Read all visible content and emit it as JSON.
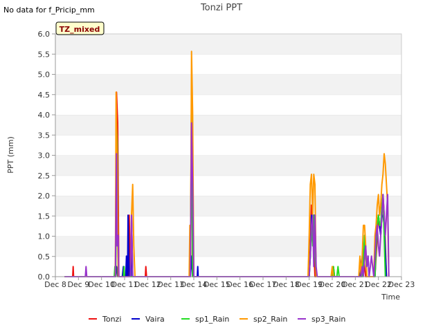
{
  "no_data_note": "No data for f_Pricip_mm",
  "tz_badge": "TZ_mixed",
  "chart_data": {
    "type": "line",
    "title": "Tonzi PPT",
    "xlabel": "Time",
    "ylabel": "PPT (mm)",
    "xlim": [
      8,
      23
    ],
    "ylim": [
      0,
      6
    ],
    "x_ticks": [
      8,
      9,
      10,
      11,
      12,
      13,
      14,
      15,
      16,
      17,
      18,
      19,
      20,
      21,
      22,
      23
    ],
    "x_tick_labels": [
      "Dec 8",
      "Dec 9",
      "Dec 10",
      "Dec 11",
      "Dec 12",
      "Dec 13",
      "Dec 14",
      "Dec 15",
      "Dec 16",
      "Dec 17",
      "Dec 18",
      "Dec 19",
      "Dec 20",
      "Dec 21",
      "Dec 22",
      "Dec 23"
    ],
    "y_ticks": [
      0,
      0.5,
      1,
      1.5,
      2,
      2.5,
      3,
      3.5,
      4,
      4.5,
      5,
      5.5,
      6
    ],
    "y_tick_labels": [
      "0.0",
      "0.5",
      "1.0",
      "1.5",
      "2.0",
      "2.5",
      "3.0",
      "3.5",
      "4.0",
      "4.5",
      "5.0",
      "5.5",
      "6.0"
    ],
    "grid": "horizontal bands",
    "legend_position": "bottom",
    "series": [
      {
        "name": "Tonzi",
        "color": "#ee1111",
        "points": [
          [
            8.4,
            0
          ],
          [
            8.75,
            0
          ],
          [
            8.77,
            0.25
          ],
          [
            8.79,
            0
          ],
          [
            10.6,
            0
          ],
          [
            10.65,
            4.56
          ],
          [
            10.7,
            3.8
          ],
          [
            10.75,
            0
          ],
          [
            11.15,
            0
          ],
          [
            11.2,
            1.52
          ],
          [
            11.25,
            0
          ],
          [
            11.9,
            0
          ],
          [
            11.92,
            0.25
          ],
          [
            11.95,
            0
          ],
          [
            13.85,
            0
          ],
          [
            13.9,
            4.56
          ],
          [
            13.95,
            0
          ],
          [
            19.0,
            0
          ],
          [
            19.05,
            0.76
          ],
          [
            19.1,
            1.77
          ],
          [
            19.15,
            1.27
          ],
          [
            19.2,
            0.76
          ],
          [
            19.25,
            0
          ],
          [
            20.0,
            0
          ],
          [
            20.05,
            0.25
          ],
          [
            20.1,
            0
          ],
          [
            21.25,
            0
          ],
          [
            21.3,
            0.25
          ],
          [
            21.35,
            0.51
          ],
          [
            21.4,
            0.25
          ],
          [
            21.45,
            0
          ],
          [
            21.85,
            0
          ],
          [
            21.9,
            0.51
          ],
          [
            21.95,
            1.02
          ],
          [
            22.0,
            1.52
          ],
          [
            22.05,
            1.27
          ],
          [
            22.1,
            1.02
          ],
          [
            22.15,
            1.52
          ],
          [
            22.2,
            2.03
          ],
          [
            22.25,
            1.52
          ],
          [
            22.35,
            0
          ]
        ]
      },
      {
        "name": "Vaira",
        "color": "#0000cc",
        "points": [
          [
            8.4,
            0
          ],
          [
            10.6,
            0
          ],
          [
            10.65,
            0.25
          ],
          [
            10.7,
            0
          ],
          [
            10.9,
            0
          ],
          [
            10.95,
            0.25
          ],
          [
            11.0,
            0
          ],
          [
            11.05,
            0
          ],
          [
            11.08,
            0.51
          ],
          [
            11.1,
            0
          ],
          [
            11.13,
            0
          ],
          [
            11.15,
            1.52
          ],
          [
            11.2,
            0
          ],
          [
            11.28,
            0
          ],
          [
            11.3,
            1.52
          ],
          [
            11.35,
            0
          ],
          [
            13.85,
            0
          ],
          [
            13.9,
            0.51
          ],
          [
            13.95,
            0
          ],
          [
            14.15,
            0
          ],
          [
            14.17,
            0.25
          ],
          [
            14.19,
            0
          ],
          [
            19.0,
            0
          ],
          [
            19.05,
            0.51
          ],
          [
            19.1,
            1.52
          ],
          [
            19.15,
            1.02
          ],
          [
            19.2,
            1.52
          ],
          [
            19.25,
            1.52
          ],
          [
            19.3,
            0
          ],
          [
            21.2,
            0
          ],
          [
            21.25,
            0.25
          ],
          [
            21.3,
            0.51
          ],
          [
            21.35,
            0.25
          ],
          [
            21.4,
            0.76
          ],
          [
            21.45,
            0.51
          ],
          [
            21.5,
            0.25
          ],
          [
            21.55,
            0.51
          ],
          [
            21.6,
            0
          ],
          [
            21.85,
            0
          ],
          [
            21.9,
            0.76
          ],
          [
            21.95,
            1.27
          ],
          [
            22.0,
            1.52
          ],
          [
            22.05,
            1.27
          ],
          [
            22.1,
            1.02
          ],
          [
            22.15,
            1.52
          ],
          [
            22.2,
            1.52
          ],
          [
            22.25,
            1.27
          ],
          [
            22.35,
            0
          ]
        ]
      },
      {
        "name": "sp1_Rain",
        "color": "#22dd22",
        "points": [
          [
            8.4,
            0
          ],
          [
            10.55,
            0
          ],
          [
            10.58,
            0.25
          ],
          [
            10.62,
            0
          ],
          [
            10.65,
            3.8
          ],
          [
            10.68,
            3.3
          ],
          [
            10.72,
            0
          ],
          [
            10.95,
            0
          ],
          [
            10.98,
            0.25
          ],
          [
            11.0,
            0
          ],
          [
            13.85,
            0
          ],
          [
            13.9,
            4.05
          ],
          [
            13.95,
            0
          ],
          [
            19.0,
            0
          ],
          [
            19.05,
            0.51
          ],
          [
            19.1,
            1.27
          ],
          [
            19.15,
            0.76
          ],
          [
            19.2,
            1.52
          ],
          [
            19.3,
            0
          ],
          [
            20.0,
            0
          ],
          [
            20.05,
            0.25
          ],
          [
            20.1,
            0
          ],
          [
            20.2,
            0
          ],
          [
            20.25,
            0.25
          ],
          [
            20.3,
            0
          ],
          [
            21.3,
            0
          ],
          [
            21.35,
            0.51
          ],
          [
            21.4,
            1.02
          ],
          [
            21.45,
            0.51
          ],
          [
            21.5,
            0
          ],
          [
            21.85,
            0
          ],
          [
            21.9,
            0.76
          ],
          [
            21.95,
            1.27
          ],
          [
            22.0,
            1.52
          ],
          [
            22.05,
            1.27
          ],
          [
            22.1,
            1.27
          ],
          [
            22.15,
            1.77
          ],
          [
            22.2,
            2.03
          ],
          [
            22.3,
            0
          ]
        ]
      },
      {
        "name": "sp2_Rain",
        "color": "#ff9900",
        "points": [
          [
            8.4,
            0
          ],
          [
            10.6,
            0
          ],
          [
            10.63,
            4.56
          ],
          [
            10.67,
            3.04
          ],
          [
            10.72,
            0
          ],
          [
            11.25,
            0
          ],
          [
            11.3,
            1.52
          ],
          [
            11.35,
            2.28
          ],
          [
            11.4,
            0.76
          ],
          [
            11.45,
            0
          ],
          [
            13.8,
            0
          ],
          [
            13.83,
            1.27
          ],
          [
            13.86,
            0.51
          ],
          [
            13.9,
            5.57
          ],
          [
            13.95,
            4.05
          ],
          [
            14.0,
            0
          ],
          [
            18.95,
            0
          ],
          [
            19.0,
            1.02
          ],
          [
            19.05,
            2.28
          ],
          [
            19.1,
            2.53
          ],
          [
            19.15,
            1.52
          ],
          [
            19.2,
            2.53
          ],
          [
            19.25,
            2.28
          ],
          [
            19.3,
            0
          ],
          [
            19.95,
            0
          ],
          [
            20.0,
            0.25
          ],
          [
            20.05,
            0
          ],
          [
            21.15,
            0
          ],
          [
            21.2,
            0.51
          ],
          [
            21.25,
            0
          ],
          [
            21.3,
            0.51
          ],
          [
            21.35,
            1.27
          ],
          [
            21.4,
            1.27
          ],
          [
            21.45,
            0.76
          ],
          [
            21.5,
            0
          ],
          [
            21.8,
            0
          ],
          [
            21.85,
            1.02
          ],
          [
            21.9,
            1.27
          ],
          [
            21.95,
            1.77
          ],
          [
            22.0,
            2.03
          ],
          [
            22.05,
            1.52
          ],
          [
            22.1,
            1.77
          ],
          [
            22.15,
            2.28
          ],
          [
            22.2,
            2.53
          ],
          [
            22.25,
            3.04
          ],
          [
            22.3,
            2.78
          ],
          [
            22.35,
            2.28
          ],
          [
            22.4,
            1.77
          ],
          [
            22.45,
            0
          ]
        ]
      },
      {
        "name": "sp3_Rain",
        "color": "#9933cc",
        "points": [
          [
            8.4,
            0
          ],
          [
            9.3,
            0
          ],
          [
            9.33,
            0.25
          ],
          [
            9.36,
            0
          ],
          [
            10.6,
            0
          ],
          [
            10.65,
            3.04
          ],
          [
            10.68,
            0.76
          ],
          [
            10.72,
            1.02
          ],
          [
            10.75,
            0
          ],
          [
            11.25,
            0
          ],
          [
            11.3,
            1.52
          ],
          [
            11.35,
            0
          ],
          [
            13.85,
            0
          ],
          [
            13.9,
            3.8
          ],
          [
            13.95,
            2.28
          ],
          [
            14.0,
            0
          ],
          [
            19.0,
            0
          ],
          [
            19.05,
            0.51
          ],
          [
            19.1,
            1.27
          ],
          [
            19.15,
            1.52
          ],
          [
            19.2,
            0.25
          ],
          [
            19.25,
            1.52
          ],
          [
            19.3,
            0.25
          ],
          [
            19.35,
            0
          ],
          [
            21.25,
            0
          ],
          [
            21.3,
            0.25
          ],
          [
            21.35,
            0
          ],
          [
            21.4,
            0.51
          ],
          [
            21.45,
            0.76
          ],
          [
            21.5,
            0.25
          ],
          [
            21.55,
            0.51
          ],
          [
            21.6,
            0
          ],
          [
            21.65,
            0.25
          ],
          [
            21.7,
            0.51
          ],
          [
            21.75,
            0.25
          ],
          [
            21.8,
            0
          ],
          [
            21.85,
            0.51
          ],
          [
            21.9,
            1.02
          ],
          [
            21.95,
            1.27
          ],
          [
            22.0,
            0.76
          ],
          [
            22.05,
            0.51
          ],
          [
            22.1,
            1.02
          ],
          [
            22.15,
            1.52
          ],
          [
            22.2,
            2.03
          ],
          [
            22.25,
            1.52
          ],
          [
            22.3,
            1.02
          ],
          [
            22.35,
            1.52
          ],
          [
            22.4,
            2.03
          ],
          [
            22.45,
            0
          ]
        ]
      }
    ]
  }
}
